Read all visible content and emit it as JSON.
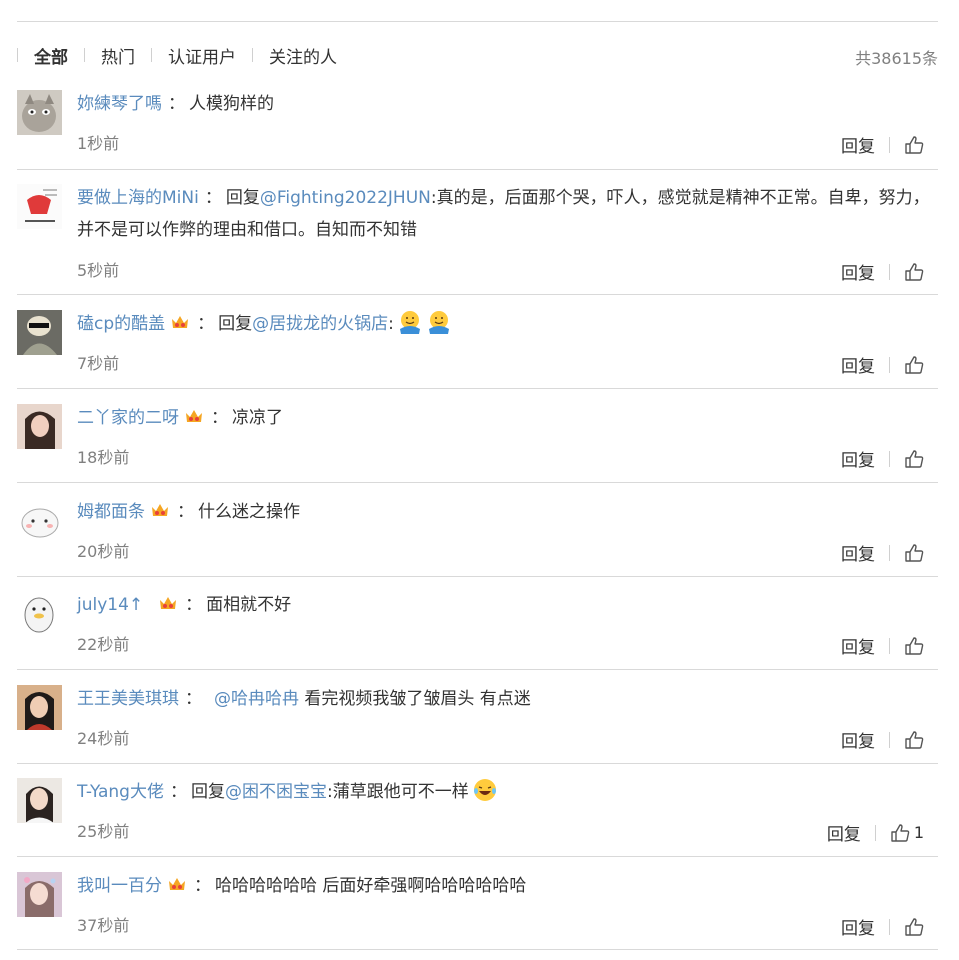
{
  "tabs": [
    {
      "label": "全部",
      "active": true
    },
    {
      "label": "热门",
      "active": false
    },
    {
      "label": "认证用户",
      "active": false
    },
    {
      "label": "关注的人",
      "active": false
    }
  ],
  "total": "共38615条",
  "reply_label": "回复",
  "comments": [
    {
      "name": "妳練琴了嗎",
      "prefix": "",
      "at": "",
      "text": "人模狗样的",
      "time": "1秒前",
      "likes": ""
    },
    {
      "name": "要做上海的MiNi",
      "prefix": "回复",
      "at": "@Fighting2022JHUN",
      "text": ":真的是，后面那个哭，吓人，感觉就是精神不正常。自卑，努力，并不是可以作弊的理由和借口。自知而不知错",
      "time": "5秒前",
      "likes": ""
    },
    {
      "name": "磕cp的酷盖",
      "prefix": "回复",
      "at": "@居拢龙的火锅店",
      "text": ":",
      "time": "7秒前",
      "likes": ""
    },
    {
      "name": "二丫家的二呀",
      "prefix": "",
      "at": "",
      "text": "凉凉了",
      "time": "18秒前",
      "likes": ""
    },
    {
      "name": "姆都面条",
      "prefix": "",
      "at": "",
      "text": "什么迷之操作",
      "time": "20秒前",
      "likes": ""
    },
    {
      "name": "july14↑",
      "prefix": "",
      "at": "",
      "text": "面相就不好",
      "time": "22秒前",
      "likes": ""
    },
    {
      "name": "王王美美琪琪",
      "prefix": "",
      "at": "@哈冉哈冉",
      "text": " 看完视频我皱了皱眉头 有点迷",
      "time": "24秒前",
      "likes": ""
    },
    {
      "name": "T-Yang大佬",
      "prefix": "回复",
      "at": "@困不困宝宝",
      "text": ":蒲草跟他可不一样",
      "time": "25秒前",
      "likes": "1"
    },
    {
      "name": "我叫一百分",
      "prefix": "",
      "at": "",
      "text": "哈哈哈哈哈哈 后面好牵强啊哈哈哈哈哈哈",
      "time": "37秒前",
      "likes": ""
    }
  ],
  "colors": {
    "link": "#5a8bbd",
    "text": "#333333",
    "muted": "#808080",
    "divider": "#d9d9d9",
    "crown": "#f5a623"
  }
}
